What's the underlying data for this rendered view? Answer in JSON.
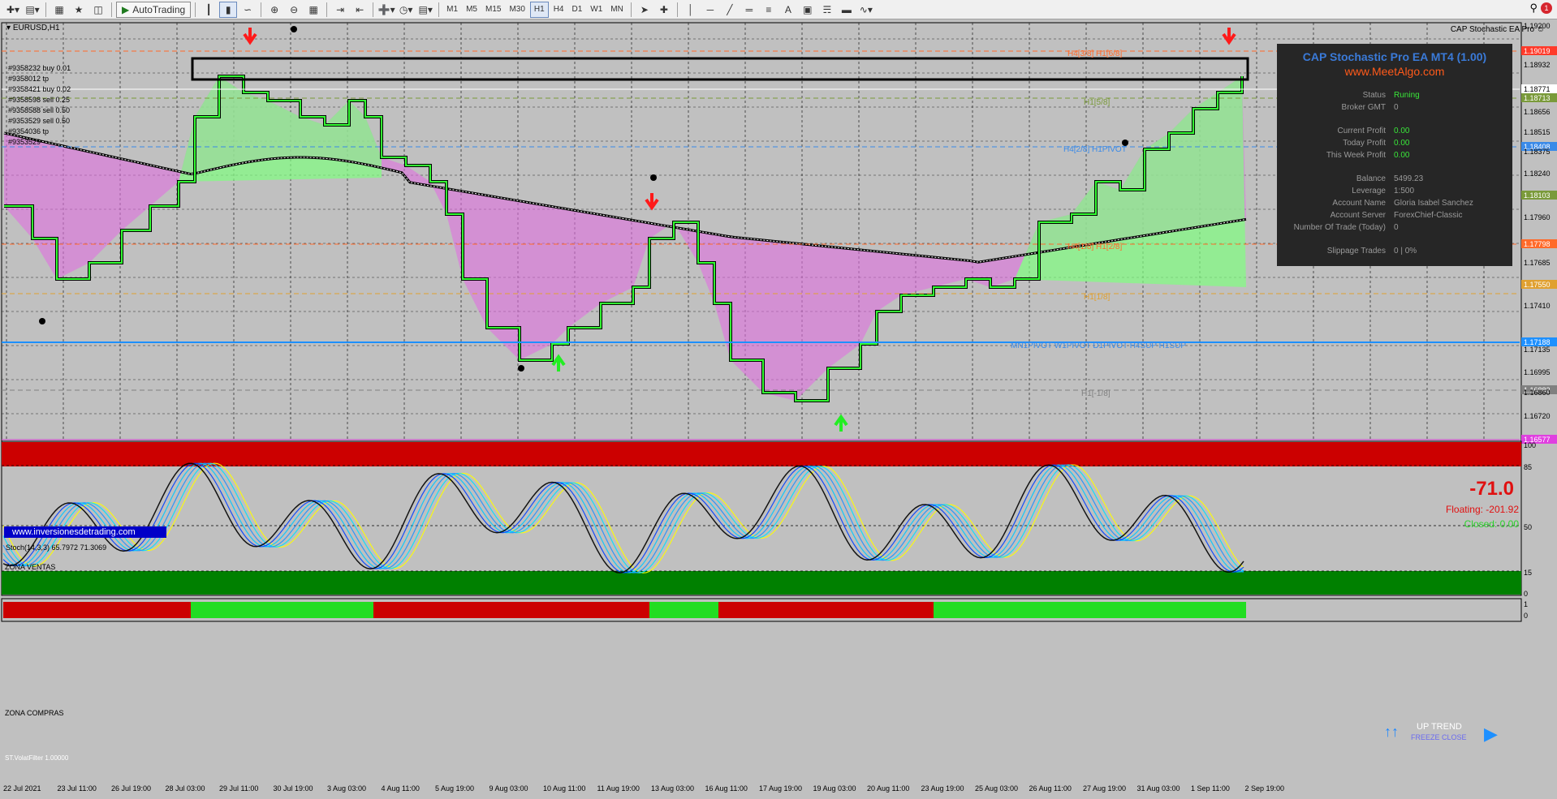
{
  "toolbar": {
    "auto_trading_label": "AutoTrading",
    "timeframes": [
      "M1",
      "M5",
      "M15",
      "M30",
      "H1",
      "H4",
      "D1",
      "W1",
      "MN"
    ],
    "active_timeframe": "H1",
    "notification_count": "1"
  },
  "chart": {
    "symbol": "EURUSD,H1",
    "ea_name": "CAP Stochastic EA Pro ☺",
    "trades": [
      "#9358232 buy 0.01",
      "#9358012 tp",
      "#9358421 buy 0.02",
      "#9358598 sell 0.25",
      "#9358588 sell 0.50",
      "#9353529 sell 0.50",
      "#9354036 tp",
      "#9353529"
    ],
    "price_labels": [
      "1.19200",
      "1.19019",
      "1.18932",
      "1.18771",
      "1.18713",
      "1.18656",
      "1.18515",
      "1.18408",
      "1.18375",
      "1.18240",
      "1.18103",
      "1.17960",
      "1.17798",
      "1.17685",
      "1.17550",
      "1.17410",
      "1.17188",
      "1.17135",
      "1.16995",
      "1.16882",
      "1.16720",
      "1.16577",
      "1.16860"
    ],
    "level_labels": [
      {
        "text": "H4[3/8] H1[6/8]",
        "color": "#ff6a2a"
      },
      {
        "text": "H1[5/8]",
        "color": "#7a9a3a"
      },
      {
        "text": "H4[2/8] H1PIVOT",
        "color": "#3a8ae8"
      },
      {
        "text": "H4[1/8] H1[2/8]",
        "color": "#ff6a2a"
      },
      {
        "text": "H1[1/8]",
        "color": "#e0a030"
      },
      {
        "text": "MN1PIVOT W1PIVOT D1PIVOT H4SUP H1SUP",
        "color": "#3a8ae8"
      },
      {
        "text": "H1[-1/8]",
        "color": "#808080"
      }
    ],
    "website_link": "www.inversionesdetrading.com",
    "profit": {
      "big": "-71.0",
      "floating": "Floating: -201.92",
      "closed": "Closed: 0.00"
    },
    "trend": {
      "label": "UP TREND",
      "sub": "FREEZE CLOSE"
    }
  },
  "panel": {
    "title": "CAP Stochastic Pro EA MT4 (1.00)",
    "url": "www.MeetAlgo.com",
    "rows": [
      {
        "label": "Status",
        "value": "Runing",
        "green": true
      },
      {
        "label": "Broker GMT",
        "value": "0",
        "gap": true
      },
      {
        "label": "Current Profit",
        "value": "0.00",
        "green": true
      },
      {
        "label": "Today Profit",
        "value": "0.00",
        "green": true
      },
      {
        "label": "This Week Profit",
        "value": "0.00",
        "green": true,
        "gap": true
      },
      {
        "label": "Balance",
        "value": "5499.23"
      },
      {
        "label": "Leverage",
        "value": "1:500"
      },
      {
        "label": "Account Name",
        "value": "Gloria Isabel Sanchez"
      },
      {
        "label": "Account Server",
        "value": "ForexChief-Classic"
      },
      {
        "label": "Number Of Trade (Today)",
        "value": "0",
        "gap": true
      },
      {
        "label": "Slippage Trades",
        "value": "0 | 0%"
      }
    ]
  },
  "stoch": {
    "label": "Stoch(14,3,3) 65.7972 71.3069",
    "zona_ventas": "ZONA VENTAS",
    "zona_compras": "ZONA COMPRAS",
    "levels": [
      "100",
      "85",
      "50",
      "15",
      "0"
    ]
  },
  "ind3": {
    "label": "ST.VolatFilter 1.00000",
    "levels": [
      "1",
      "0"
    ]
  },
  "dates": [
    "22 Jul 2021",
    "23 Jul 11:00",
    "26 Jul 19:00",
    "28 Jul 03:00",
    "29 Jul 11:00",
    "30 Jul 19:00",
    "3 Aug 03:00",
    "4 Aug 11:00",
    "5 Aug 19:00",
    "9 Aug 03:00",
    "10 Aug 11:00",
    "11 Aug 19:00",
    "13 Aug 03:00",
    "16 Aug 11:00",
    "17 Aug 19:00",
    "19 Aug 03:00",
    "20 Aug 11:00",
    "23 Aug 19:00",
    "25 Aug 03:00",
    "26 Aug 11:00",
    "27 Aug 19:00",
    "31 Aug 03:00",
    "1 Sep 11:00",
    "2 Sep 19:00"
  ],
  "colors": {
    "bg": "#c0c0c0",
    "bull": "#80ff80",
    "bear": "#ff50ff",
    "sell_zone": "#cc0000",
    "buy_zone": "#008000"
  }
}
